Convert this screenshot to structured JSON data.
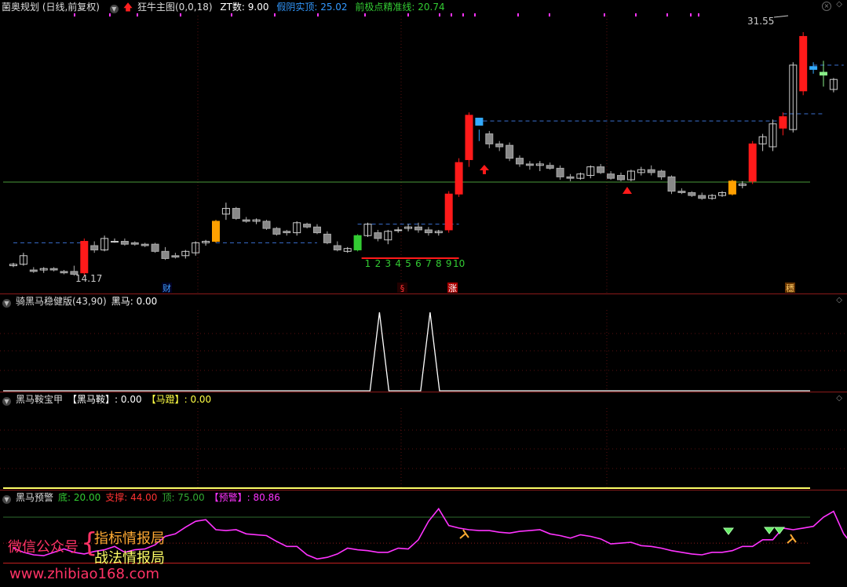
{
  "colors": {
    "up": "#ff1a1a",
    "down": "#9a9a9a",
    "blue": "#33aaff",
    "yellow": "#ffff66",
    "magenta": "#ff33ff",
    "green": "#33cc33",
    "orange": "#ffa000",
    "grid": "#5a1010"
  },
  "main": {
    "title": "菌奥规划 (日线,前复权)",
    "indicator": "狂牛主图(0,0,18)",
    "zt_label": "ZT数: 9.00",
    "fake_label": "假阴实顶: 25.02",
    "std_label": "前极点精准线: 20.74",
    "high_price": "31.55",
    "low_price": "14.17",
    "count_labels": [
      "1",
      "2",
      "3",
      "4",
      "5",
      "6",
      "7",
      "8",
      "9",
      "10"
    ],
    "markers": [
      "财",
      "§",
      "涨",
      "穩"
    ]
  },
  "panel1": {
    "title": "骑黑马稳健版(43,90)",
    "value": "黑马: 0.00"
  },
  "panel2": {
    "title": "黑马鞍宝甲",
    "v1": "【黑马鞍】: 0.00",
    "v2": "【马蹬】: 0.00"
  },
  "panel3": {
    "title": "黑马预警",
    "bottom": "底: 20.00",
    "support": "支撑: 44.00",
    "top": "顶: 75.00",
    "alert": "【预警】: 80.86"
  },
  "watermark": {
    "line1": "微信公众号",
    "line2a": "指标情报局",
    "line2b": "战法情报局",
    "url": "www.zhibiao168.com"
  },
  "chart_data": {
    "type": "candlestick",
    "candles": [
      [
        14.9,
        15.1,
        14.8,
        15.0
      ],
      [
        15.0,
        15.8,
        14.9,
        15.6
      ],
      [
        14.6,
        14.8,
        14.4,
        14.5
      ],
      [
        14.6,
        14.8,
        14.4,
        14.7
      ],
      [
        14.7,
        14.8,
        14.5,
        14.6
      ],
      [
        14.5,
        14.6,
        14.3,
        14.4
      ],
      [
        14.5,
        14.9,
        14.2,
        14.3
      ],
      [
        14.4,
        16.8,
        14.2,
        16.6
      ],
      [
        16.3,
        16.6,
        15.8,
        16.0
      ],
      [
        16.0,
        17.0,
        15.9,
        16.8
      ],
      [
        16.6,
        16.8,
        16.5,
        16.6
      ],
      [
        16.6,
        16.8,
        16.3,
        16.4
      ],
      [
        16.5,
        16.6,
        16.3,
        16.4
      ],
      [
        16.4,
        16.5,
        16.2,
        16.3
      ],
      [
        16.4,
        16.5,
        15.8,
        15.9
      ],
      [
        15.9,
        16.2,
        15.3,
        15.4
      ],
      [
        15.6,
        15.8,
        15.4,
        15.5
      ],
      [
        15.6,
        16.0,
        15.4,
        15.9
      ],
      [
        15.8,
        16.6,
        15.6,
        16.5
      ],
      [
        16.5,
        16.7,
        16.3,
        16.6
      ],
      [
        16.6,
        18.1,
        16.5,
        18.0
      ],
      [
        18.5,
        19.3,
        18.1,
        18.9
      ],
      [
        18.9,
        19.0,
        18.1,
        18.2
      ],
      [
        18.1,
        18.3,
        17.9,
        18.0
      ],
      [
        18.0,
        18.2,
        17.8,
        18.1
      ],
      [
        18.0,
        18.1,
        17.4,
        17.5
      ],
      [
        17.5,
        17.6,
        17.0,
        17.1
      ],
      [
        17.3,
        17.4,
        17.0,
        17.2
      ],
      [
        17.2,
        18.0,
        17.0,
        17.9
      ],
      [
        17.8,
        17.9,
        17.5,
        17.6
      ],
      [
        17.6,
        17.8,
        17.1,
        17.2
      ],
      [
        17.1,
        17.3,
        16.4,
        16.5
      ],
      [
        16.3,
        16.6,
        15.9,
        16.0
      ],
      [
        15.9,
        16.2,
        15.8,
        16.1
      ],
      [
        16.0,
        17.1,
        15.9,
        17.0
      ],
      [
        17.0,
        17.9,
        16.9,
        17.8
      ],
      [
        17.2,
        17.4,
        16.6,
        16.8
      ],
      [
        16.7,
        17.4,
        16.4,
        17.3
      ],
      [
        17.4,
        17.6,
        17.2,
        17.4
      ],
      [
        17.5,
        17.8,
        17.3,
        17.6
      ],
      [
        17.6,
        17.9,
        17.2,
        17.4
      ],
      [
        17.4,
        17.6,
        17.0,
        17.2
      ],
      [
        17.2,
        17.4,
        17.0,
        17.3
      ],
      [
        17.4,
        20.1,
        17.2,
        19.9
      ],
      [
        19.9,
        22.4,
        19.7,
        22.1
      ],
      [
        22.3,
        25.6,
        21.8,
        25.4
      ],
      [
        25.2,
        24.4,
        23.6,
        24.7
      ],
      [
        24.1,
        24.3,
        23.1,
        23.4
      ],
      [
        23.4,
        23.6,
        22.9,
        23.2
      ],
      [
        23.3,
        23.5,
        22.2,
        22.4
      ],
      [
        22.4,
        22.6,
        21.8,
        22.0
      ],
      [
        22.0,
        22.2,
        21.6,
        21.9
      ],
      [
        21.9,
        22.2,
        21.5,
        22.0
      ],
      [
        21.9,
        22.1,
        21.6,
        21.7
      ],
      [
        21.7,
        21.9,
        20.9,
        21.1
      ],
      [
        21.1,
        21.3,
        20.8,
        21.0
      ],
      [
        21.0,
        21.4,
        20.9,
        21.3
      ],
      [
        21.2,
        21.9,
        21.0,
        21.8
      ],
      [
        21.8,
        22.0,
        21.3,
        21.4
      ],
      [
        21.3,
        21.5,
        20.9,
        21.0
      ],
      [
        21.2,
        21.4,
        20.8,
        20.9
      ],
      [
        20.9,
        21.6,
        20.8,
        21.5
      ],
      [
        21.4,
        21.8,
        21.2,
        21.6
      ],
      [
        21.6,
        21.9,
        21.2,
        21.4
      ],
      [
        21.5,
        21.6,
        20.9,
        21.1
      ],
      [
        21.1,
        21.2,
        19.9,
        20.1
      ],
      [
        20.1,
        20.3,
        19.9,
        20.0
      ],
      [
        20.0,
        20.1,
        19.7,
        19.8
      ],
      [
        19.8,
        20.0,
        19.5,
        19.6
      ],
      [
        19.6,
        19.9,
        19.5,
        19.8
      ],
      [
        19.8,
        20.1,
        19.7,
        20.0
      ],
      [
        19.9,
        20.9,
        19.8,
        20.8
      ],
      [
        20.5,
        20.8,
        20.3,
        20.6
      ],
      [
        20.8,
        23.6,
        20.6,
        23.4
      ],
      [
        23.4,
        24.1,
        22.9,
        23.9
      ],
      [
        23.2,
        25.1,
        22.9,
        24.8
      ],
      [
        24.5,
        25.6,
        24.0,
        25.3
      ],
      [
        24.4,
        29.1,
        24.2,
        28.9
      ],
      [
        27.1,
        31.2,
        26.8,
        30.9
      ],
      [
        28.8,
        29.1,
        28.3,
        28.6
      ],
      [
        28.4,
        29.2,
        27.4,
        28.2
      ],
      [
        27.2,
        28.0,
        27.0,
        27.9
      ]
    ],
    "levels": {
      "green_line": 20.74,
      "dash_upper_1": 25.02,
      "dash_upper_2": 28.9
    },
    "zt_count": 9.0,
    "heima_panel": {
      "value": 0.0,
      "spikes_index": [
        36,
        41
      ]
    },
    "anbao_panel": {
      "heima_an": 0.0,
      "ma_deng": 0.0
    },
    "warning_panel": {
      "bottom": 20.0,
      "support": 44.0,
      "top": 75.0,
      "alert": 80.86,
      "series": [
        38,
        33,
        30,
        29,
        33,
        37,
        33,
        31,
        34,
        36,
        40,
        33,
        36,
        37,
        42,
        52,
        55,
        63,
        70,
        72,
        60,
        59,
        60,
        55,
        54,
        53,
        46,
        40,
        40,
        30,
        25,
        27,
        31,
        38,
        36,
        35,
        33,
        33,
        38,
        37,
        48,
        70,
        85,
        65,
        62,
        60,
        59,
        59,
        57,
        56,
        58,
        59,
        60,
        55,
        53,
        50,
        54,
        52,
        49,
        43,
        44,
        45,
        41,
        40,
        38,
        35,
        33,
        31,
        30,
        33,
        33,
        35,
        40,
        40,
        48,
        48,
        62,
        60,
        62,
        64,
        75,
        82,
        55,
        40,
        45
      ]
    }
  }
}
